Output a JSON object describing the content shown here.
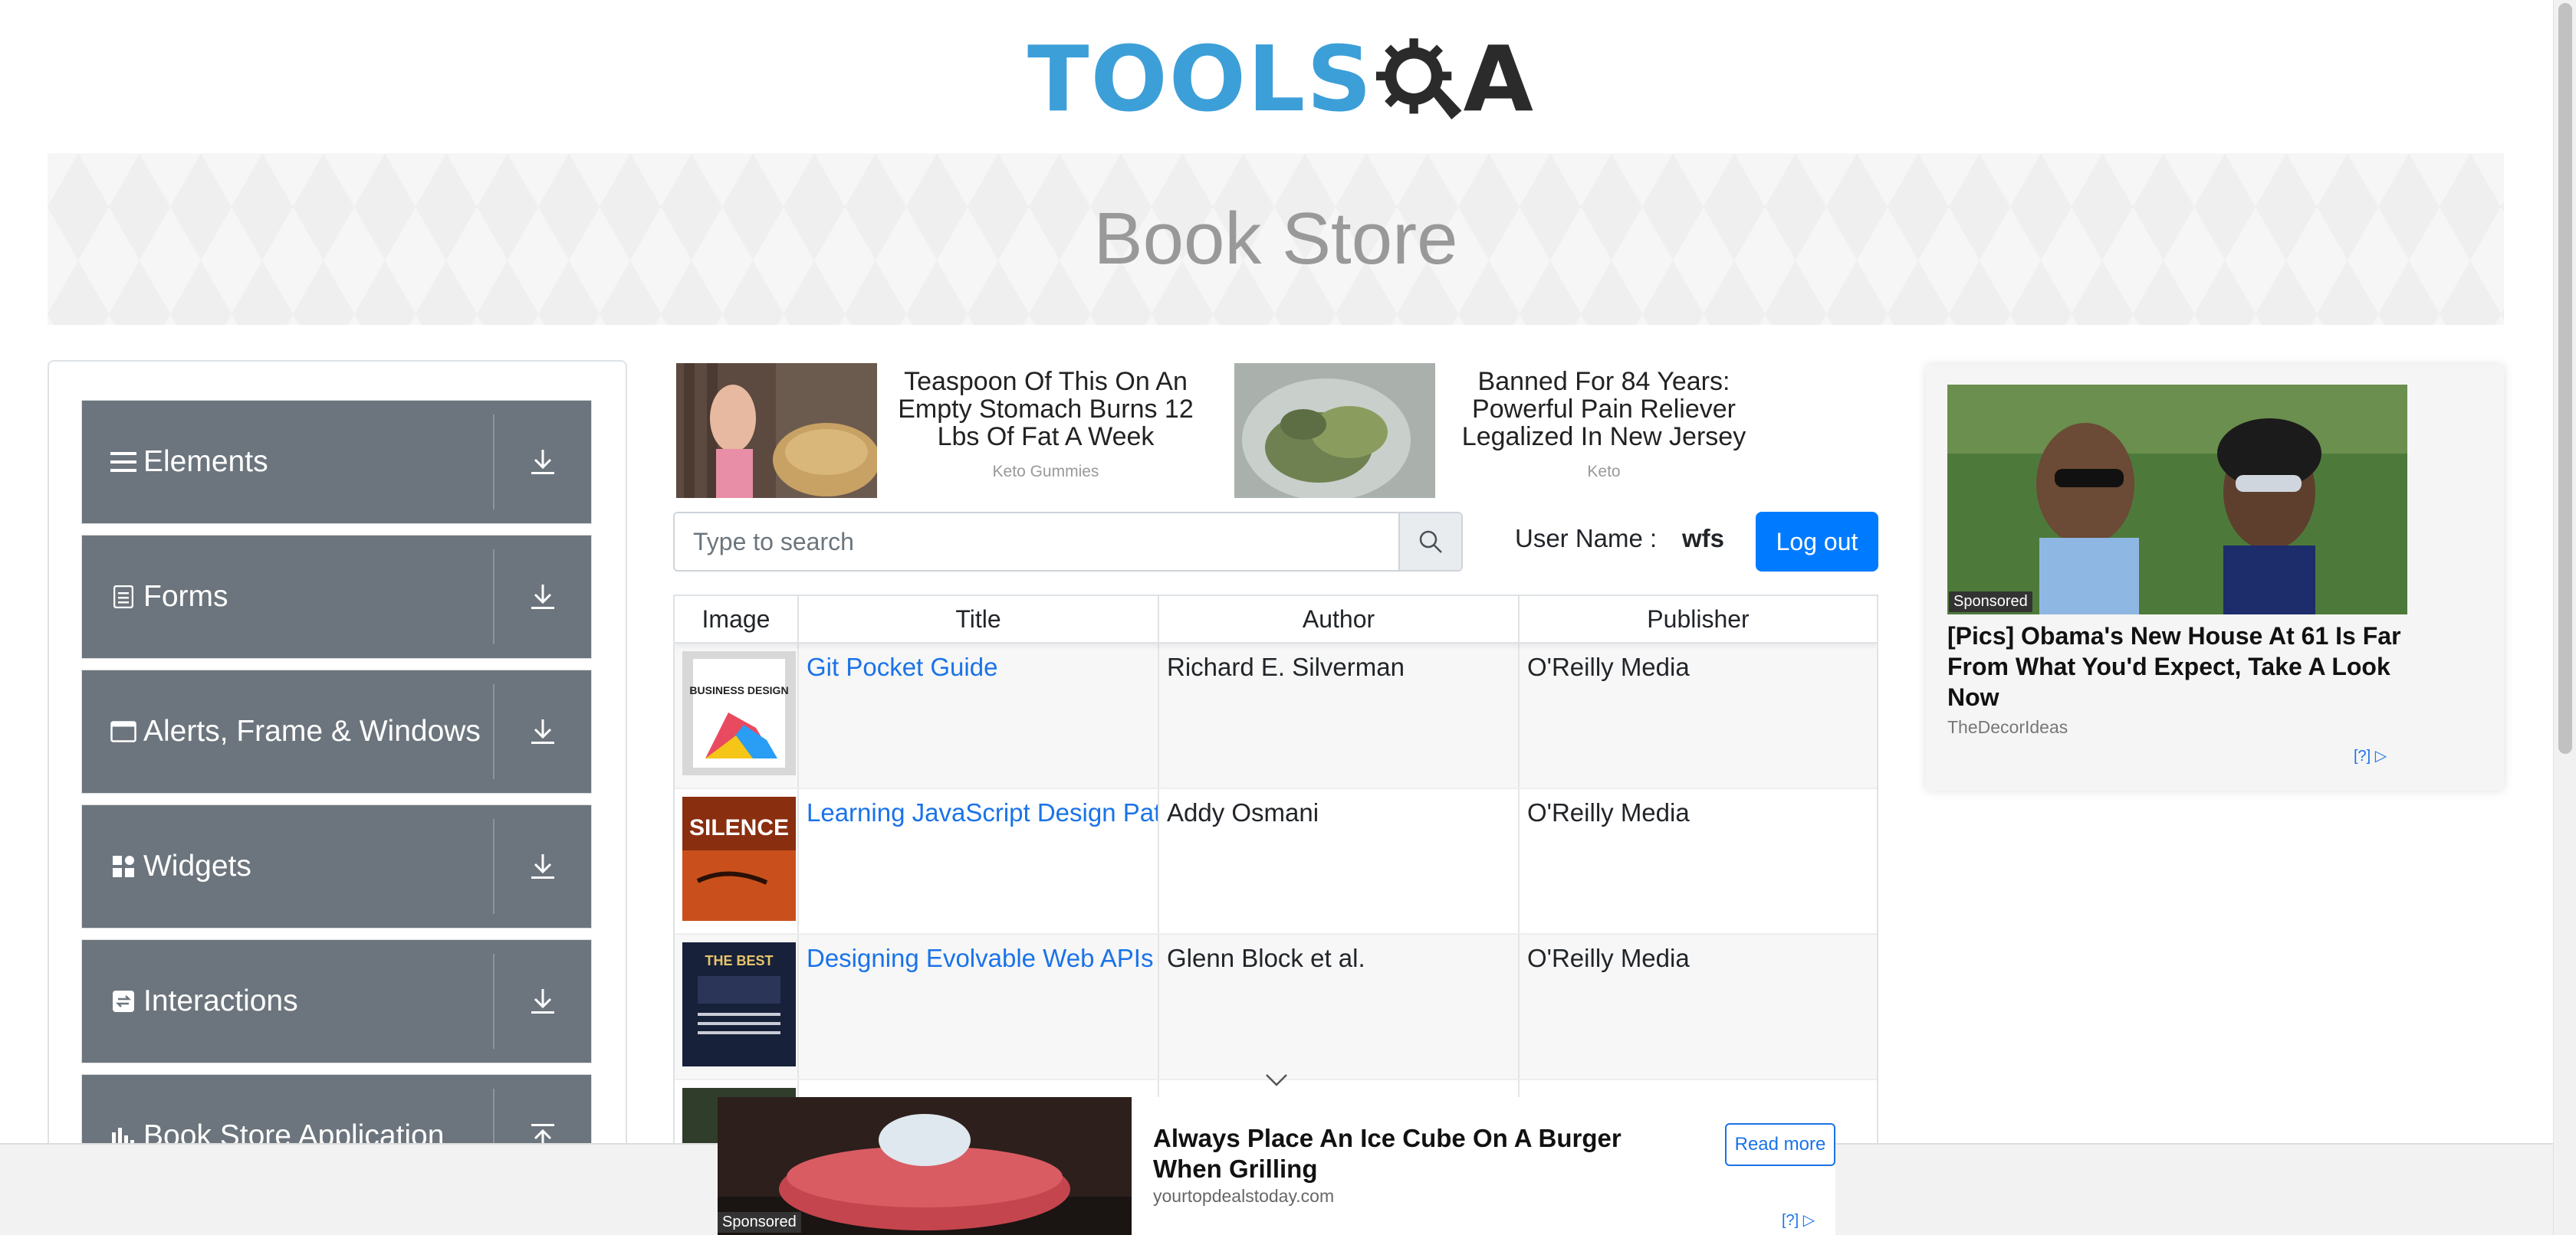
{
  "brand": {
    "logo_left": "TOOLS",
    "logo_right": "A"
  },
  "banner": {
    "title": "Book Store"
  },
  "sidebar": {
    "groups": [
      {
        "label": "Elements",
        "icon": "hamburger-icon",
        "state": "collapsed"
      },
      {
        "label": "Forms",
        "icon": "document-icon",
        "state": "collapsed"
      },
      {
        "label": "Alerts, Frame & Windows",
        "icon": "window-icon",
        "state": "collapsed"
      },
      {
        "label": "Widgets",
        "icon": "widgets-icon",
        "state": "collapsed"
      },
      {
        "label": "Interactions",
        "icon": "interactions-icon",
        "state": "collapsed"
      },
      {
        "label": "Book Store Application",
        "icon": "bar-chart-icon",
        "state": "expanded"
      }
    ]
  },
  "ads_inline": [
    {
      "text": "Teaspoon Of This On An Empty Stomach Burns 12 Lbs Of Fat A Week",
      "source": "Keto Gummies"
    },
    {
      "text": "Banned For 84 Years: Powerful Pain Reliever Legalized In New Jersey",
      "source": "Keto"
    }
  ],
  "search": {
    "placeholder": "Type to search"
  },
  "user": {
    "label": "User Name :",
    "value": "wfs"
  },
  "logout_label": "Log out",
  "table": {
    "headers": [
      "Image",
      "Title",
      "Author",
      "Publisher"
    ],
    "rows": [
      {
        "title": "Git Pocket Guide",
        "author": "Richard E. Silverman",
        "publisher": "O'Reilly Media",
        "cover_text": "BUSINESS DESIGN"
      },
      {
        "title": "Learning JavaScript Design Patterns",
        "author": "Addy Osmani",
        "publisher": "O'Reilly Media",
        "cover_text": "SILENCE"
      },
      {
        "title": "Designing Evolvable Web APIs with ASP.NET",
        "author": "Glenn Block et al.",
        "publisher": "O'Reilly Media",
        "cover_text": "THE BEST"
      }
    ]
  },
  "ad_side": {
    "tag": "Sponsored",
    "headline": "[Pics] Obama's New House At 61 Is Far From What You'd Expect, Take A Look Now",
    "source": "TheDecorIdeas",
    "choice": "[?]"
  },
  "ad_bottom": {
    "tag": "Sponsored",
    "headline": "Always Place An Ice Cube On A Burger When Grilling",
    "source": "yourtopdealstoday.com",
    "cta": "Read more",
    "choice": "[?]"
  },
  "colors": {
    "accent": "#007bff",
    "nav_bg": "#6c757d",
    "logo_blue": "#3d9fd8",
    "link": "#1a73e8"
  }
}
